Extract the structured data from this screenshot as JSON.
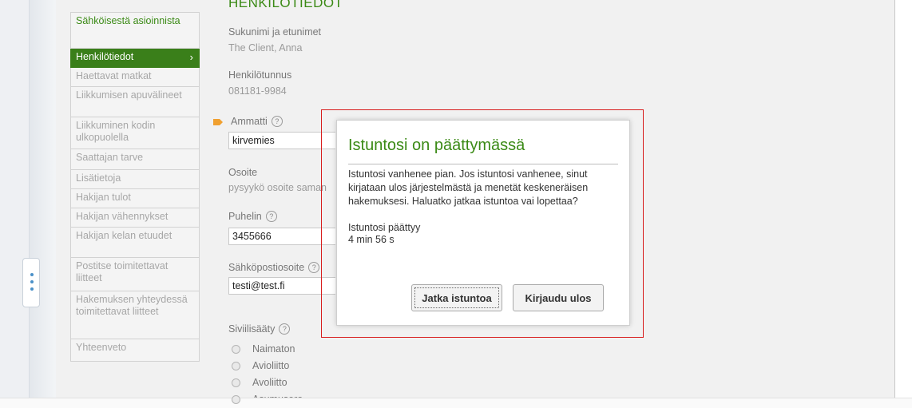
{
  "sidebar": {
    "items": [
      {
        "label": "Sähköisestä asioinnista"
      },
      {
        "label": "Henkilötiedot",
        "chevron": "›"
      },
      {
        "label": "Haettavat matkat"
      },
      {
        "label": "Liikkumisen apuvälineet"
      },
      {
        "label": "Liikkuminen kodin ulkopuolella"
      },
      {
        "label": "Saattajan tarve"
      },
      {
        "label": "Lisätietoja"
      },
      {
        "label": "Hakijan tulot"
      },
      {
        "label": "Hakijan vähennykset"
      },
      {
        "label": "Hakijan kelan etuudet"
      },
      {
        "label": "Postitse toimitettavat liitteet"
      },
      {
        "label": "Hakemuksen yhteydessä toimitettavat liitteet"
      },
      {
        "label": "Yhteenveto"
      }
    ]
  },
  "form": {
    "title": "HENKILÖTIEDOT",
    "name_label": "Sukunimi ja etunimet",
    "name_value": "The Client, Anna",
    "ssn_label": "Henkilötunnus",
    "ssn_value": "081181-9984",
    "occupation_label": "Ammatti",
    "occupation_value": "kirvemies",
    "address_label": "Osoite",
    "address_value": "pysyykö osoite saman",
    "phone_label": "Puhelin",
    "phone_value": "3455666",
    "email_label": "Sähköpostiosoite",
    "email_value": "testi@test.fi",
    "marital_label": "Siviilisääty",
    "help_glyph": "?",
    "marital_options": [
      "Naimaton",
      "Avioliitto",
      "Avoliitto",
      "Asumusero"
    ]
  },
  "dialog": {
    "title": "Istuntosi on päättymässä",
    "message": "Istuntosi vanhenee pian. Jos istuntosi vanhenee, sinut kirjataan ulos järjestelmästä ja menetät keskeneräisen hakemuksesi. Haluatko jatkaa istuntoa vai lopettaa?",
    "ends_label": "Istuntosi päättyy",
    "time_remaining": "4 min 56 s",
    "continue_button": "Jatka istuntoa",
    "logout_button": "Kirjaudu ulos"
  },
  "colors": {
    "accent_green": "#3a7f1a",
    "highlight_red": "#d81e1e",
    "marker_orange": "#f0a030"
  },
  "icons": {
    "sidebar_handle": "more-vertical-icon",
    "required_marker": "arrow-tag-icon",
    "help": "help-circle-icon"
  }
}
